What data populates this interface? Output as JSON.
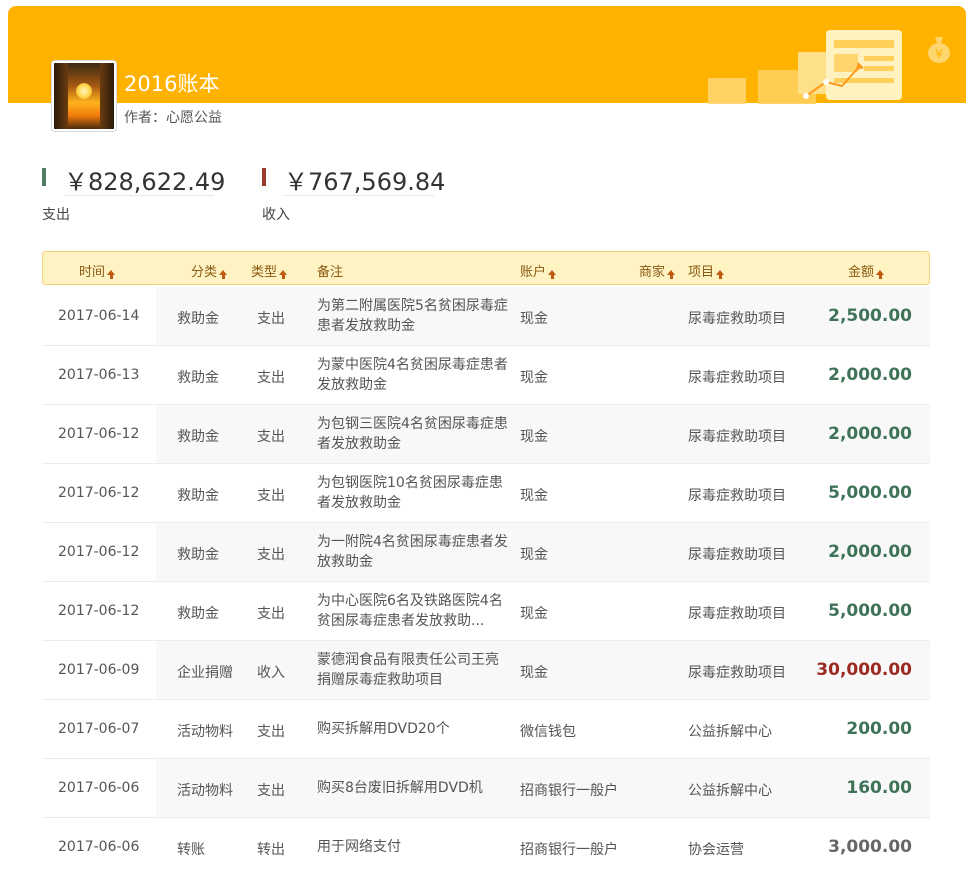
{
  "book": {
    "title": "2016账本",
    "author": "作者：心愿公益"
  },
  "summary": {
    "expense": {
      "amount": "￥828,622.49",
      "label": "支出",
      "color": "#4f7d66"
    },
    "income": {
      "amount": "￥767,569.84",
      "label": "收入",
      "color": "#9b3a2e"
    }
  },
  "table": {
    "headers": {
      "time": "时间",
      "category": "分类",
      "type": "类型",
      "note": "备注",
      "account": "账户",
      "merchant": "商家",
      "project": "项目",
      "amount": "金额"
    },
    "rows": [
      {
        "date": "2017-06-14",
        "category": "救助金",
        "type": "支出",
        "note": "为第二附属医院5名贫困尿毒症患者发放救助金",
        "account": "现金",
        "project": "尿毒症救助项目",
        "amount": "2,500.00",
        "kind": "expense"
      },
      {
        "date": "2017-06-13",
        "category": "救助金",
        "type": "支出",
        "note": "为蒙中医院4名贫困尿毒症患者发放救助金",
        "account": "现金",
        "project": "尿毒症救助项目",
        "amount": "2,000.00",
        "kind": "expense"
      },
      {
        "date": "2017-06-12",
        "category": "救助金",
        "type": "支出",
        "note": "为包钢三医院4名贫困尿毒症患者发放救助金",
        "account": "现金",
        "project": "尿毒症救助项目",
        "amount": "2,000.00",
        "kind": "expense"
      },
      {
        "date": "2017-06-12",
        "category": "救助金",
        "type": "支出",
        "note": "为包钢医院10名贫困尿毒症患者发放救助金",
        "account": "现金",
        "project": "尿毒症救助项目",
        "amount": "5,000.00",
        "kind": "expense"
      },
      {
        "date": "2017-06-12",
        "category": "救助金",
        "type": "支出",
        "note": "为一附院4名贫困尿毒症患者发放救助金",
        "account": "现金",
        "project": "尿毒症救助项目",
        "amount": "2,000.00",
        "kind": "expense"
      },
      {
        "date": "2017-06-12",
        "category": "救助金",
        "type": "支出",
        "note": "为中心医院6名及铁路医院4名贫困尿毒症患者发放救助...",
        "account": "现金",
        "project": "尿毒症救助项目",
        "amount": "5,000.00",
        "kind": "expense"
      },
      {
        "date": "2017-06-09",
        "category": "企业捐赠",
        "type": "收入",
        "note": "蒙德润食品有限责任公司王亮捐赠尿毒症救助项目",
        "account": "现金",
        "project": "尿毒症救助项目",
        "amount": "30,000.00",
        "kind": "income"
      },
      {
        "date": "2017-06-07",
        "category": "活动物料",
        "type": "支出",
        "note": "购买拆解用DVD20个",
        "account": "微信钱包",
        "project": "公益拆解中心",
        "amount": "200.00",
        "kind": "expense"
      },
      {
        "date": "2017-06-06",
        "category": "活动物料",
        "type": "支出",
        "note": "购买8台废旧拆解用DVD机",
        "account": "招商银行一般户",
        "project": "公益拆解中心",
        "amount": "160.00",
        "kind": "expense"
      },
      {
        "date": "2017-06-06",
        "category": "转账",
        "type": "转出",
        "note": "用于网络支付",
        "account": "招商银行一般户",
        "project": "协会运营",
        "amount": "3,000.00",
        "kind": "transfer"
      }
    ]
  },
  "colors": {
    "banner": "#ffb300",
    "expense": "#3f7358",
    "income": "#9b2a22",
    "transfer": "#666666",
    "header_bg": "#fff3c4",
    "sort_arrow": "#c05a10"
  },
  "icons": {
    "sort": "sort-arrow-up-icon",
    "decoration": "document-chart-decoration-icon",
    "money_bag": "money-bag-icon"
  }
}
